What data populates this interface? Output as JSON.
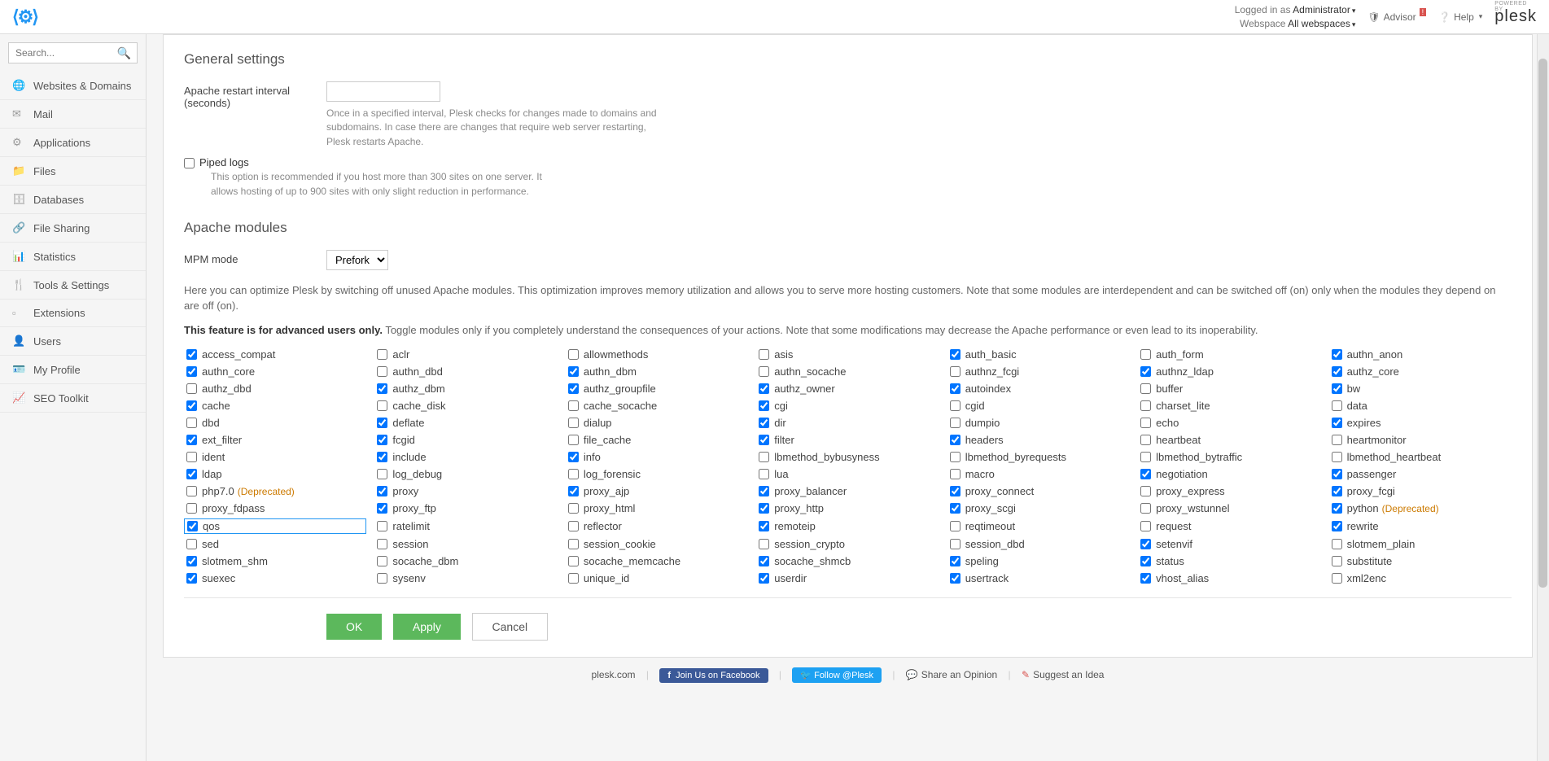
{
  "header": {
    "logged_in_as": "Logged in as",
    "user": "Administrator",
    "webspace_label": "Webspace",
    "webspace_value": "All webspaces",
    "advisor": "Advisor",
    "help": "Help",
    "powered_by": "POWERED BY",
    "brand": "plesk"
  },
  "search": {
    "placeholder": "Search..."
  },
  "nav": {
    "websites": "Websites & Domains",
    "mail": "Mail",
    "applications": "Applications",
    "files": "Files",
    "databases": "Databases",
    "filesharing": "File Sharing",
    "statistics": "Statistics",
    "tools": "Tools & Settings",
    "extensions": "Extensions",
    "users": "Users",
    "profile": "My Profile",
    "seo": "SEO Toolkit"
  },
  "general": {
    "title": "General settings",
    "restart_label": "Apache restart interval (seconds)",
    "restart_help": "Once in a specified interval, Plesk checks for changes made to domains and subdomains. In case there are changes that require web server restarting, Plesk restarts Apache.",
    "piped_label": "Piped logs",
    "piped_help": "This option is recommended if you host more than 300 sites on one server. It allows hosting of up to 900 sites with only slight reduction in performance."
  },
  "apache": {
    "title": "Apache modules",
    "mpm_label": "MPM mode",
    "mpm_value": "Prefork",
    "info": "Here you can optimize Plesk by switching off unused Apache modules. This optimization improves memory utilization and allows you to serve more hosting customers. Note that some modules are interdependent and can be switched off (on) only when the modules they depend on are off (on).",
    "warning_strong": "This feature is for advanced users only.",
    "warning_rest": " Toggle modules only if you completely understand the consequences of your actions. Note that some modifications may decrease the Apache performance or even lead to its inoperability.",
    "deprecated_tag": "(Deprecated)"
  },
  "modules": [
    {
      "n": "access_compat",
      "c": true
    },
    {
      "n": "aclr",
      "c": false
    },
    {
      "n": "allowmethods",
      "c": false
    },
    {
      "n": "asis",
      "c": false
    },
    {
      "n": "auth_basic",
      "c": true
    },
    {
      "n": "auth_form",
      "c": false
    },
    {
      "n": "authn_anon",
      "c": true
    },
    {
      "n": "authn_core",
      "c": true
    },
    {
      "n": "authn_dbd",
      "c": false
    },
    {
      "n": "authn_dbm",
      "c": true
    },
    {
      "n": "authn_socache",
      "c": false
    },
    {
      "n": "authnz_fcgi",
      "c": false
    },
    {
      "n": "authnz_ldap",
      "c": true
    },
    {
      "n": "authz_core",
      "c": true
    },
    {
      "n": "authz_dbd",
      "c": false
    },
    {
      "n": "authz_dbm",
      "c": true
    },
    {
      "n": "authz_groupfile",
      "c": true
    },
    {
      "n": "authz_owner",
      "c": true
    },
    {
      "n": "autoindex",
      "c": true
    },
    {
      "n": "buffer",
      "c": false
    },
    {
      "n": "bw",
      "c": true
    },
    {
      "n": "cache",
      "c": true
    },
    {
      "n": "cache_disk",
      "c": false
    },
    {
      "n": "cache_socache",
      "c": false
    },
    {
      "n": "cgi",
      "c": true
    },
    {
      "n": "cgid",
      "c": false
    },
    {
      "n": "charset_lite",
      "c": false
    },
    {
      "n": "data",
      "c": false
    },
    {
      "n": "dbd",
      "c": false
    },
    {
      "n": "deflate",
      "c": true
    },
    {
      "n": "dialup",
      "c": false
    },
    {
      "n": "dir",
      "c": true
    },
    {
      "n": "dumpio",
      "c": false
    },
    {
      "n": "echo",
      "c": false
    },
    {
      "n": "expires",
      "c": true
    },
    {
      "n": "ext_filter",
      "c": true
    },
    {
      "n": "fcgid",
      "c": true
    },
    {
      "n": "file_cache",
      "c": false
    },
    {
      "n": "filter",
      "c": true
    },
    {
      "n": "headers",
      "c": true
    },
    {
      "n": "heartbeat",
      "c": false
    },
    {
      "n": "heartmonitor",
      "c": false
    },
    {
      "n": "ident",
      "c": false
    },
    {
      "n": "include",
      "c": true
    },
    {
      "n": "info",
      "c": true
    },
    {
      "n": "lbmethod_bybusyness",
      "c": false
    },
    {
      "n": "lbmethod_byrequests",
      "c": false
    },
    {
      "n": "lbmethod_bytraffic",
      "c": false
    },
    {
      "n": "lbmethod_heartbeat",
      "c": false
    },
    {
      "n": "ldap",
      "c": true
    },
    {
      "n": "log_debug",
      "c": false
    },
    {
      "n": "log_forensic",
      "c": false
    },
    {
      "n": "lua",
      "c": false
    },
    {
      "n": "macro",
      "c": false
    },
    {
      "n": "negotiation",
      "c": true
    },
    {
      "n": "passenger",
      "c": true
    },
    {
      "n": "php7.0",
      "c": false,
      "dep": true
    },
    {
      "n": "proxy",
      "c": true
    },
    {
      "n": "proxy_ajp",
      "c": true
    },
    {
      "n": "proxy_balancer",
      "c": true
    },
    {
      "n": "proxy_connect",
      "c": true
    },
    {
      "n": "proxy_express",
      "c": false
    },
    {
      "n": "proxy_fcgi",
      "c": true
    },
    {
      "n": "proxy_fdpass",
      "c": false
    },
    {
      "n": "proxy_ftp",
      "c": true
    },
    {
      "n": "proxy_html",
      "c": false
    },
    {
      "n": "proxy_http",
      "c": true
    },
    {
      "n": "proxy_scgi",
      "c": true
    },
    {
      "n": "proxy_wstunnel",
      "c": false
    },
    {
      "n": "python",
      "c": true,
      "dep": true
    },
    {
      "n": "qos",
      "c": true,
      "focus": true
    },
    {
      "n": "ratelimit",
      "c": false
    },
    {
      "n": "reflector",
      "c": false
    },
    {
      "n": "remoteip",
      "c": true
    },
    {
      "n": "reqtimeout",
      "c": false
    },
    {
      "n": "request",
      "c": false
    },
    {
      "n": "rewrite",
      "c": true
    },
    {
      "n": "sed",
      "c": false
    },
    {
      "n": "session",
      "c": false
    },
    {
      "n": "session_cookie",
      "c": false
    },
    {
      "n": "session_crypto",
      "c": false
    },
    {
      "n": "session_dbd",
      "c": false
    },
    {
      "n": "setenvif",
      "c": true
    },
    {
      "n": "slotmem_plain",
      "c": false
    },
    {
      "n": "slotmem_shm",
      "c": true
    },
    {
      "n": "socache_dbm",
      "c": false
    },
    {
      "n": "socache_memcache",
      "c": false
    },
    {
      "n": "socache_shmcb",
      "c": true
    },
    {
      "n": "speling",
      "c": true
    },
    {
      "n": "status",
      "c": true
    },
    {
      "n": "substitute",
      "c": false
    },
    {
      "n": "suexec",
      "c": true
    },
    {
      "n": "sysenv",
      "c": false
    },
    {
      "n": "unique_id",
      "c": false
    },
    {
      "n": "userdir",
      "c": true
    },
    {
      "n": "usertrack",
      "c": true
    },
    {
      "n": "vhost_alias",
      "c": true
    },
    {
      "n": "xml2enc",
      "c": false
    }
  ],
  "buttons": {
    "ok": "OK",
    "apply": "Apply",
    "cancel": "Cancel"
  },
  "footer": {
    "site": "plesk.com",
    "fb": "Join Us on Facebook",
    "tw": "Follow @Plesk",
    "opinion": "Share an Opinion",
    "idea": "Suggest an Idea"
  }
}
